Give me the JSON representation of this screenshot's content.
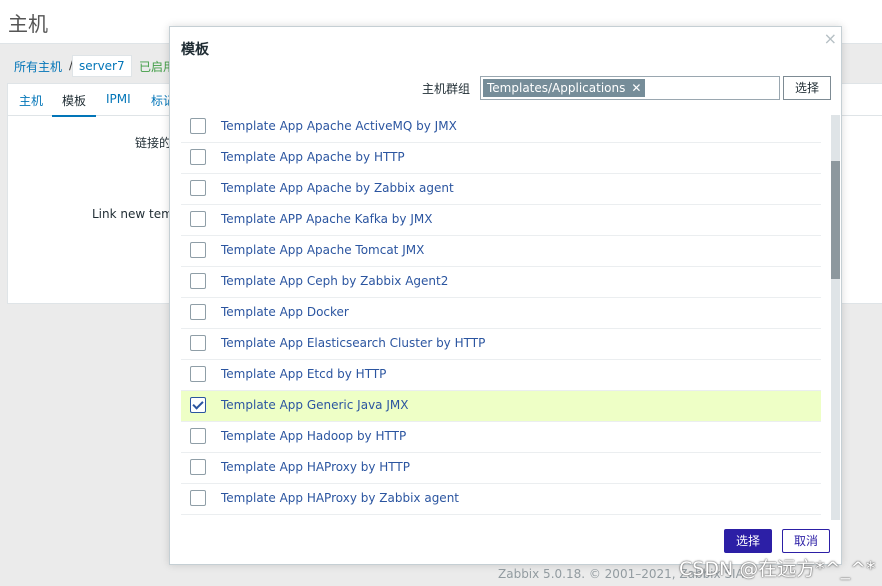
{
  "page": {
    "title": "主机",
    "breadcrumb": {
      "all_hosts": "所有主机",
      "separator": "/",
      "host": "server7",
      "status": "已启用"
    },
    "tabs": [
      "主机",
      "模板",
      "IPMI",
      "标记"
    ],
    "form": {
      "linked_label": "链接的",
      "link_new_label": "Link new temp"
    }
  },
  "modal": {
    "title": "模板",
    "close_icon": "close-icon",
    "filter": {
      "label": "主机群组",
      "chip": "Templates/Applications",
      "chip_remove": "✕",
      "select_button": "选择"
    },
    "items": [
      {
        "label": "Template App Apache ActiveMQ by JMX",
        "checked": false
      },
      {
        "label": "Template App Apache by HTTP",
        "checked": false
      },
      {
        "label": "Template App Apache by Zabbix agent",
        "checked": false
      },
      {
        "label": "Template APP Apache Kafka by JMX",
        "checked": false
      },
      {
        "label": "Template App Apache Tomcat JMX",
        "checked": false
      },
      {
        "label": "Template App Ceph by Zabbix Agent2",
        "checked": false
      },
      {
        "label": "Template App Docker",
        "checked": false
      },
      {
        "label": "Template App Elasticsearch Cluster by HTTP",
        "checked": false
      },
      {
        "label": "Template App Etcd by HTTP",
        "checked": false
      },
      {
        "label": "Template App Generic Java JMX",
        "checked": true
      },
      {
        "label": "Template App Hadoop by HTTP",
        "checked": false
      },
      {
        "label": "Template App HAProxy by HTTP",
        "checked": false
      },
      {
        "label": "Template App HAProxy by Zabbix agent",
        "checked": false
      }
    ],
    "buttons": {
      "select": "选择",
      "cancel": "取消"
    }
  },
  "footer": "Zabbix 5.0.18. © 2001–2021, Zabbix SIA",
  "watermark": "CSDN @在远方*^_^*",
  "colors": {
    "accent": "#2c1fa6",
    "link": "#2b55a0",
    "highlight": "#eeffc6",
    "status_green": "#429e47"
  }
}
